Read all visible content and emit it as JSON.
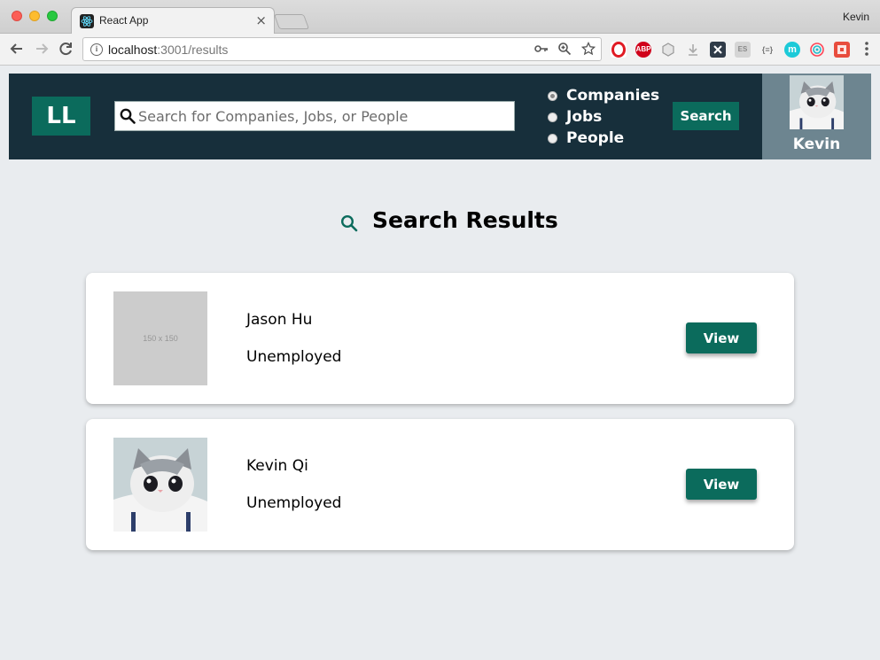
{
  "browser": {
    "tab_title": "React App",
    "tab_close": "×",
    "profile_name": "Kevin",
    "url_host": "localhost",
    "url_path": ":3001/results",
    "ext_abp": "ABP",
    "ext_es": "ES",
    "ext_json": "{≡}",
    "ext_m": "m"
  },
  "header": {
    "logo": "LL",
    "search_placeholder": "Search for Companies, Jobs, or People",
    "search_value": "",
    "radio_options": [
      {
        "label": "Companies",
        "checked": true
      },
      {
        "label": "Jobs",
        "checked": false
      },
      {
        "label": "People",
        "checked": false
      }
    ],
    "search_button": "Search",
    "user_name": "Kevin"
  },
  "results": {
    "title": "Search Results",
    "items": [
      {
        "name": "Jason Hu",
        "status": "Unemployed",
        "image_text": "150 x 150",
        "view_label": "View"
      },
      {
        "name": "Kevin Qi",
        "status": "Unemployed",
        "image_text": "",
        "view_label": "View"
      }
    ]
  },
  "colors": {
    "header_bg": "#172f3b",
    "accent": "#0b6b5c",
    "user_panel_bg": "#6d8590",
    "page_bg": "#e9ecef"
  }
}
